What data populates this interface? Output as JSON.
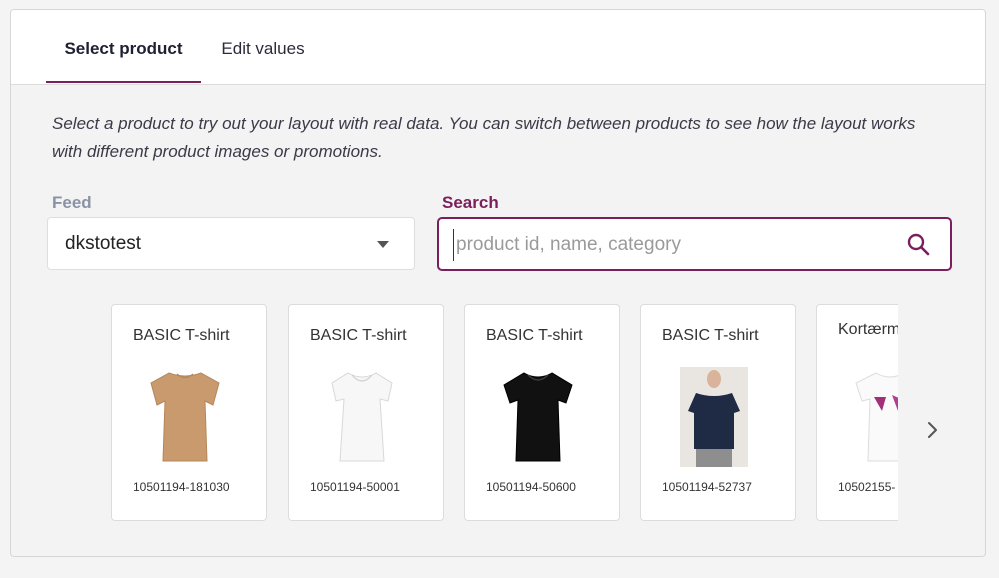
{
  "tabs": [
    {
      "label": "Select product",
      "active": true
    },
    {
      "label": "Edit values",
      "active": false
    }
  ],
  "intro": "Select a product to try out your layout with real data. You can switch between products to see how the layout works with different product images or promotions.",
  "feed": {
    "label": "Feed",
    "value": "dkstotest"
  },
  "search": {
    "label": "Search",
    "value": "",
    "placeholder": "product id, name, category"
  },
  "colors": {
    "accent": "#7b1f5c",
    "muted_label": "#8a93a6"
  },
  "products": [
    {
      "name": "BASIC T-shirt",
      "id": "10501194-181030",
      "image": "tan-tshirt"
    },
    {
      "name": "BASIC T-shirt",
      "id": "10501194-50001",
      "image": "white-tshirt"
    },
    {
      "name": "BASIC T-shirt",
      "id": "10501194-50600",
      "image": "black-tshirt"
    },
    {
      "name": "BASIC T-shirt",
      "id": "10501194-52737",
      "image": "navy-tshirt-model"
    },
    {
      "name": "Kortærmet t-shirt",
      "id": "10502155-",
      "image": "white-print-tshirt"
    }
  ],
  "icons": {
    "search": "search-icon",
    "dropdown": "chevron-down-icon",
    "next": "chevron-right-icon"
  }
}
